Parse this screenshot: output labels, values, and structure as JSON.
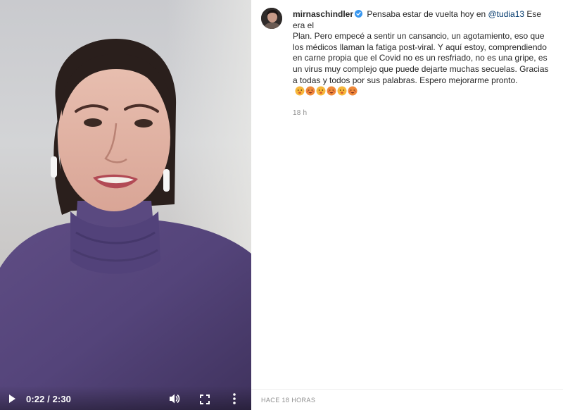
{
  "video": {
    "current_time": "0:22",
    "separator": "/",
    "duration": "2:30",
    "icons": [
      "play-icon",
      "volume-icon",
      "fullscreen-icon",
      "more-options-icon"
    ]
  },
  "post": {
    "username": "mirnaschindler",
    "verified": true,
    "caption_lines": [
      "Pensaba estar de vuelta hoy en ",
      "@tudia13",
      " Ese era el",
      "Plan. Pero empecé a sentir un cansancio, un agotamiento, eso que los médicos llaman la fatiga post-viral. Y aquí estoy, comprendiendo en carne propia que el Covid no es un resfriado, no es una gripe, es un virus muy complejo que puede dejarte muchas secuelas. Gracias a todas y todos por sus palabras. Espero mejorarme pronto."
    ],
    "emojis": [
      "sick-face-emoji",
      "hot-face-emoji",
      "sick-face-emoji",
      "hot-face-emoji",
      "sick-face-emoji",
      "hot-face-emoji"
    ],
    "relative_time": "18 h",
    "footer_time": "HACE 18 HORAS"
  },
  "colors": {
    "link": "#00376b",
    "verified_badge": "#3897f0",
    "muted_text": "#8e8e8e",
    "sweater": "#5b4a7e"
  }
}
